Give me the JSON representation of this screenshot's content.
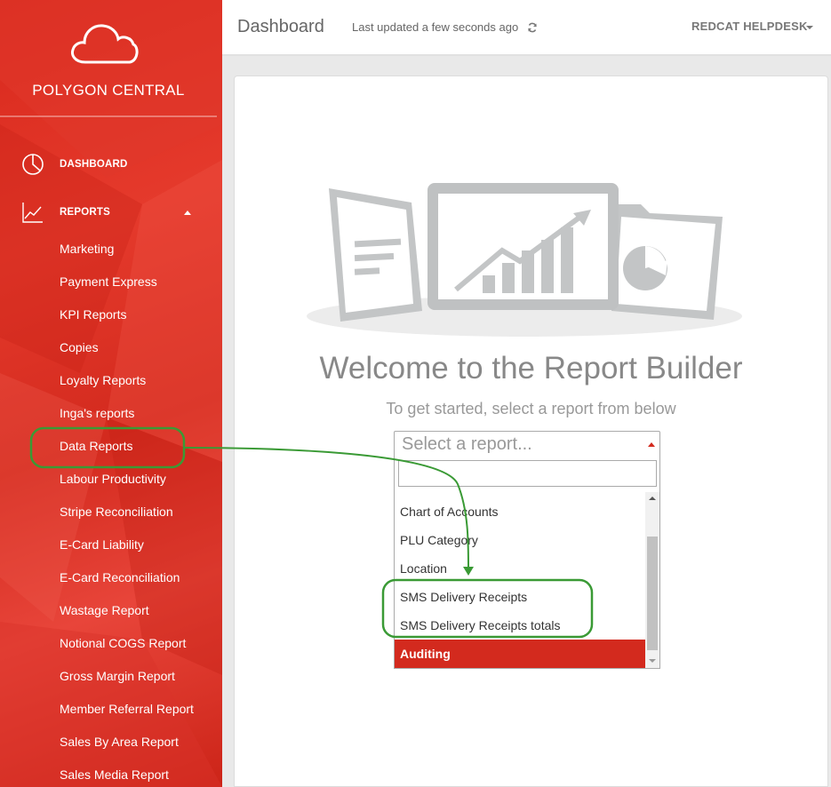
{
  "sidebar": {
    "brand": "POLYGON CENTRAL",
    "nav": [
      {
        "label": "DASHBOARD",
        "icon": "pie-chart-icon"
      },
      {
        "label": "REPORTS",
        "icon": "line-chart-icon"
      }
    ],
    "report_items": [
      {
        "label": "Marketing"
      },
      {
        "label": "Payment Express"
      },
      {
        "label": "KPI Reports"
      },
      {
        "label": "Copies"
      },
      {
        "label": "Loyalty Reports"
      },
      {
        "label": "Inga's reports"
      },
      {
        "label": "Data Reports"
      },
      {
        "label": "Labour Productivity"
      },
      {
        "label": "Stripe Reconciliation"
      },
      {
        "label": "E-Card Liability"
      },
      {
        "label": "E-Card Reconciliation"
      },
      {
        "label": "Wastage Report"
      },
      {
        "label": "Notional COGS Report"
      },
      {
        "label": "Gross Margin Report"
      },
      {
        "label": "Member Referral Report"
      },
      {
        "label": "Sales By Area Report"
      },
      {
        "label": "Sales Media Report"
      }
    ]
  },
  "header": {
    "title": "Dashboard",
    "updated": "Last updated a few seconds ago",
    "user": "REDCAT HELPDESK"
  },
  "main": {
    "welcome": "Welcome to the Report Builder",
    "subtitle": "To get started, select a report from below",
    "select": {
      "placeholder": "Select a report...",
      "search_value": "",
      "options": [
        {
          "label": "Chart of Accounts",
          "active": false
        },
        {
          "label": "PLU Category",
          "active": false
        },
        {
          "label": "Location",
          "active": false
        },
        {
          "label": "SMS Delivery Receipts",
          "active": false
        },
        {
          "label": "SMS Delivery Receipts totals",
          "active": false
        },
        {
          "label": "Auditing",
          "active": true
        }
      ]
    }
  },
  "colors": {
    "brand_red": "#d32a1e",
    "annotation_green": "#3a9a35",
    "illustration_gray": "#bfc1c2"
  }
}
